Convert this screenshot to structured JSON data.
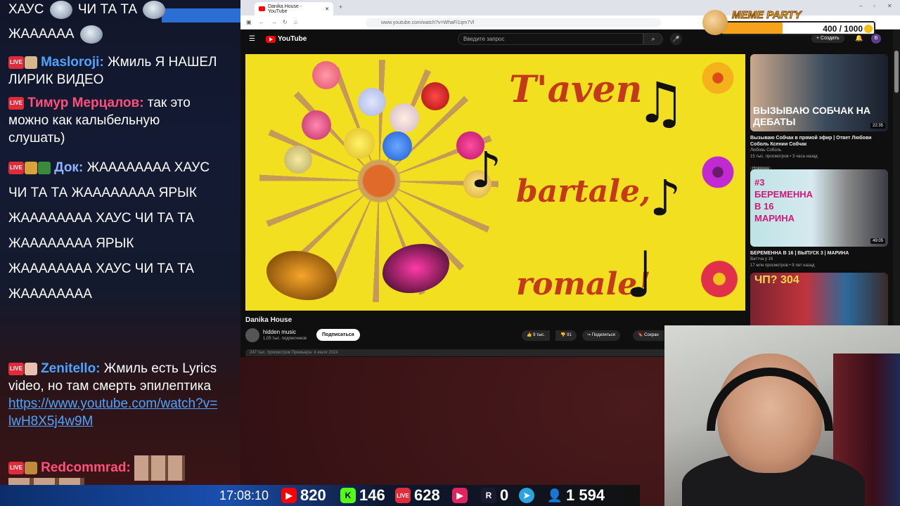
{
  "chat": {
    "messages": [
      {
        "id": "m0",
        "text_a": "ХАУС",
        "text_b": "ЧИ ТА ТА"
      },
      {
        "id": "m0b",
        "text": "ЖАААААА"
      },
      {
        "id": "m1",
        "name": "Masloroji:",
        "name_color": "#4fa3ff",
        "text": "Жмиль Я НАШЕЛ ЛИРИК ВИДЕО"
      },
      {
        "id": "m2",
        "name": "Тимур Мерцалов:",
        "name_color": "#ff4f7a",
        "text": "так это можно как калыбельную слушать)"
      },
      {
        "id": "m3",
        "name": "Док:",
        "name_color": "#8ab4ff",
        "text": "ЖАААААААА ХАУС ЧИ ТА ТА ЖАААААААА ЯРЫК ЖАААААААА ХАУС ЧИ ТА ТА ЖАААААААА ЯРЫК ЖАААААААА ХАУС ЧИ ТА ТА ЖАААААААА"
      },
      {
        "id": "m4",
        "name": "Zenitello:",
        "name_color": "#4fa3ff",
        "text": "Жмиль есть Lyrics video, но там смерть эпилептика",
        "link": "https://www.youtube.com/watch?v=lwH8X5j4w9M"
      },
      {
        "id": "m5",
        "name": "Redcommrad:",
        "name_color": "#ff4f7a"
      }
    ],
    "live_badge": "LIVE"
  },
  "status": {
    "time": "17:08:10",
    "youtube_viewers": "820",
    "kick_viewers": "146",
    "live_viewers": "628",
    "vk_viewers": "",
    "rutube_viewers": "0",
    "telegram": "",
    "total_viewers": "1 594"
  },
  "browser": {
    "tab_title": "Danika House - YouTube",
    "url": "www.youtube.com/watch?v=WhaFi1qm7Vl"
  },
  "youtube": {
    "logo": "YouTube",
    "search_placeholder": "Введите запрос",
    "create_label": "+ Создать",
    "avatar_letter": "B",
    "video": {
      "overlay_line1": "T'aven",
      "overlay_line2": "bartale,",
      "overlay_line3": "romale!",
      "title": "Danika House",
      "channel": "hidden music",
      "subscribers": "1,05 тыс. подписчиков",
      "subscribe_label": "Подписаться",
      "likes": "9 тыс.",
      "dislikes": "91",
      "share_label": "Поделиться",
      "save_label": "Сохран",
      "description": "247 тыс. просмотров  Премьера: 4 июля 2024"
    },
    "suggestions": [
      {
        "title": "Вызываю Собчак в прямой эфир | Ответ Любови Соболь Ксении Собчак",
        "channel": "Любовь Соболь",
        "meta": "15 тыс. просмотров • 3 часа назад",
        "badge": "Новинка",
        "duration": "22:35",
        "thumb_text": "ВЫЗЫВАЮ СОБЧАК НА ДЕБАТЫ"
      },
      {
        "title": "БЕРЕМЕННА В 16 | ВЫПУСК 3 | МАРИНА",
        "channel": "Ваттча у 16",
        "meta": "17 млн просмотров • 9 лет назад",
        "duration": "49:05",
        "thumb_text": "#3 БЕРЕМЕННА В 16 МАРИНА"
      },
      {
        "title": "",
        "channel": "",
        "meta": "",
        "duration": "",
        "thumb_text": "ЧП? 304"
      }
    ]
  },
  "meme_party": {
    "label": "MEME PARTY",
    "progress_text": "400 / 1000",
    "progress": 0.4
  }
}
